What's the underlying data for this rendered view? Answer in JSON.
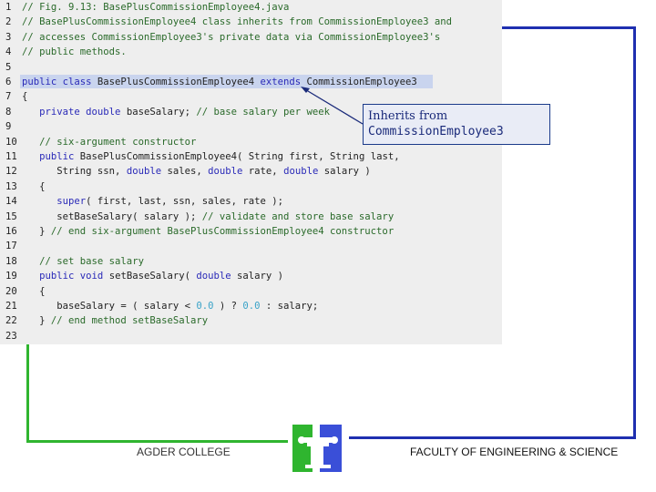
{
  "code_listing": {
    "lines": [
      {
        "num": "1",
        "tokens": [
          {
            "t": "// Fig. 9.13: BasePlusCommissionEmployee4.java",
            "c": "cm"
          }
        ]
      },
      {
        "num": "2",
        "tokens": [
          {
            "t": "// BasePlusCommissionEmployee4 class inherits from CommissionEmployee3 and",
            "c": "cm"
          }
        ]
      },
      {
        "num": "3",
        "tokens": [
          {
            "t": "// accesses CommissionEmployee3's private data via CommissionEmployee3's",
            "c": "cm"
          }
        ]
      },
      {
        "num": "4",
        "tokens": [
          {
            "t": "// public methods.",
            "c": "cm"
          }
        ]
      },
      {
        "num": "5",
        "tokens": []
      },
      {
        "num": "6",
        "tokens": [
          {
            "t": "public class ",
            "c": "kw"
          },
          {
            "t": "BasePlusCommissionEmployee4 ",
            "c": ""
          },
          {
            "t": "extends",
            "c": "kw"
          },
          {
            "t": " CommissionEmployee3",
            "c": ""
          }
        ]
      },
      {
        "num": "7",
        "tokens": [
          {
            "t": "{",
            "c": ""
          }
        ]
      },
      {
        "num": "8",
        "tokens": [
          {
            "t": "   ",
            "c": ""
          },
          {
            "t": "private double ",
            "c": "kw"
          },
          {
            "t": "baseSalary; ",
            "c": ""
          },
          {
            "t": "// base salary per week",
            "c": "cm"
          }
        ]
      },
      {
        "num": "9",
        "tokens": []
      },
      {
        "num": "10",
        "tokens": [
          {
            "t": "   ",
            "c": ""
          },
          {
            "t": "// six-argument constructor",
            "c": "cm"
          }
        ]
      },
      {
        "num": "11",
        "tokens": [
          {
            "t": "   ",
            "c": ""
          },
          {
            "t": "public ",
            "c": "kw"
          },
          {
            "t": "BasePlusCommissionEmployee4( String first, String last,",
            "c": ""
          }
        ]
      },
      {
        "num": "12",
        "tokens": [
          {
            "t": "      String ssn, ",
            "c": ""
          },
          {
            "t": "double ",
            "c": "kw"
          },
          {
            "t": "sales, ",
            "c": ""
          },
          {
            "t": "double ",
            "c": "kw"
          },
          {
            "t": "rate, ",
            "c": ""
          },
          {
            "t": "double ",
            "c": "kw"
          },
          {
            "t": "salary )",
            "c": ""
          }
        ]
      },
      {
        "num": "13",
        "tokens": [
          {
            "t": "   {",
            "c": ""
          }
        ]
      },
      {
        "num": "14",
        "tokens": [
          {
            "t": "      ",
            "c": ""
          },
          {
            "t": "super",
            "c": "kw"
          },
          {
            "t": "( first, last, ssn, sales, rate );",
            "c": ""
          }
        ]
      },
      {
        "num": "15",
        "tokens": [
          {
            "t": "      setBaseSalary( salary ); ",
            "c": ""
          },
          {
            "t": "// validate and store base salary",
            "c": "cm"
          }
        ]
      },
      {
        "num": "16",
        "tokens": [
          {
            "t": "   } ",
            "c": ""
          },
          {
            "t": "// end six-argument BasePlusCommissionEmployee4 constructor",
            "c": "cm"
          }
        ]
      },
      {
        "num": "17",
        "tokens": []
      },
      {
        "num": "18",
        "tokens": [
          {
            "t": "   ",
            "c": ""
          },
          {
            "t": "// set base salary",
            "c": "cm"
          }
        ]
      },
      {
        "num": "19",
        "tokens": [
          {
            "t": "   ",
            "c": ""
          },
          {
            "t": "public void ",
            "c": "kw"
          },
          {
            "t": "setBaseSalary( ",
            "c": ""
          },
          {
            "t": "double ",
            "c": "kw"
          },
          {
            "t": "salary )",
            "c": ""
          }
        ]
      },
      {
        "num": "20",
        "tokens": [
          {
            "t": "   {",
            "c": ""
          }
        ]
      },
      {
        "num": "21",
        "tokens": [
          {
            "t": "      baseSalary = ( salary < ",
            "c": ""
          },
          {
            "t": "0.0",
            "c": "num"
          },
          {
            "t": " ) ? ",
            "c": ""
          },
          {
            "t": "0.0",
            "c": "num"
          },
          {
            "t": " : salary;",
            "c": ""
          }
        ]
      },
      {
        "num": "22",
        "tokens": [
          {
            "t": "   } ",
            "c": ""
          },
          {
            "t": "// end method setBaseSalary",
            "c": "cm"
          }
        ]
      },
      {
        "num": "23",
        "tokens": []
      }
    ]
  },
  "callout": {
    "line1": "Inherits from",
    "line2": "CommissionEmployee3"
  },
  "footer": {
    "left_text": "AGDER COLLEGE",
    "right_text": "FACULTY OF ENGINEERING & SCIENCE"
  },
  "colors": {
    "keyword": "#2a2ab8",
    "comment": "#2a6a2a",
    "number": "#3aa3c8",
    "frame_blue": "#1f2fb0",
    "frame_green": "#2fb52f"
  },
  "icons": {
    "logo": "agder-college-logo-icon"
  }
}
